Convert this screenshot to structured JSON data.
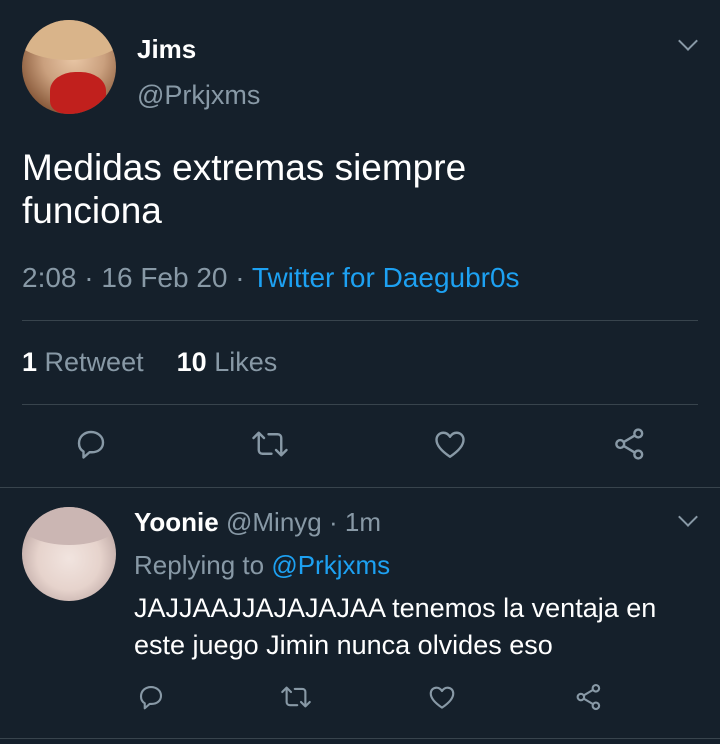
{
  "main_tweet": {
    "display_name": "Jims",
    "handle": "@Prkjxms",
    "text_line1": "Medidas extremas siempre",
    "text_line2": "funciona",
    "time": "2:08",
    "sep1": "·",
    "date": "16 Feb 20",
    "sep2": "·",
    "source": "Twitter for Daegubr0s",
    "retweets_count": "1",
    "retweets_label": "Retweet",
    "likes_count": "10",
    "likes_label": "Likes"
  },
  "reply_tweet": {
    "display_name": "Yoonie",
    "handle": "@Minyg",
    "sep": "·",
    "time_ago": "1m",
    "replying_prefix": "Replying to",
    "replying_handle": "@Prkjxms",
    "text_line1": "JAJJAAJJAJAJAJAA tenemos la ventaja en",
    "text_line2": "este juego Jimin nunca olvides eso"
  },
  "icons": {
    "reply": "reply-icon",
    "retweet": "retweet-icon",
    "like": "heart-icon",
    "share": "share-icon",
    "more": "chevron-down-icon"
  },
  "colors": {
    "background": "#15202b",
    "accent": "#1da1f2",
    "muted": "#8899a6",
    "divider": "#38444d"
  }
}
